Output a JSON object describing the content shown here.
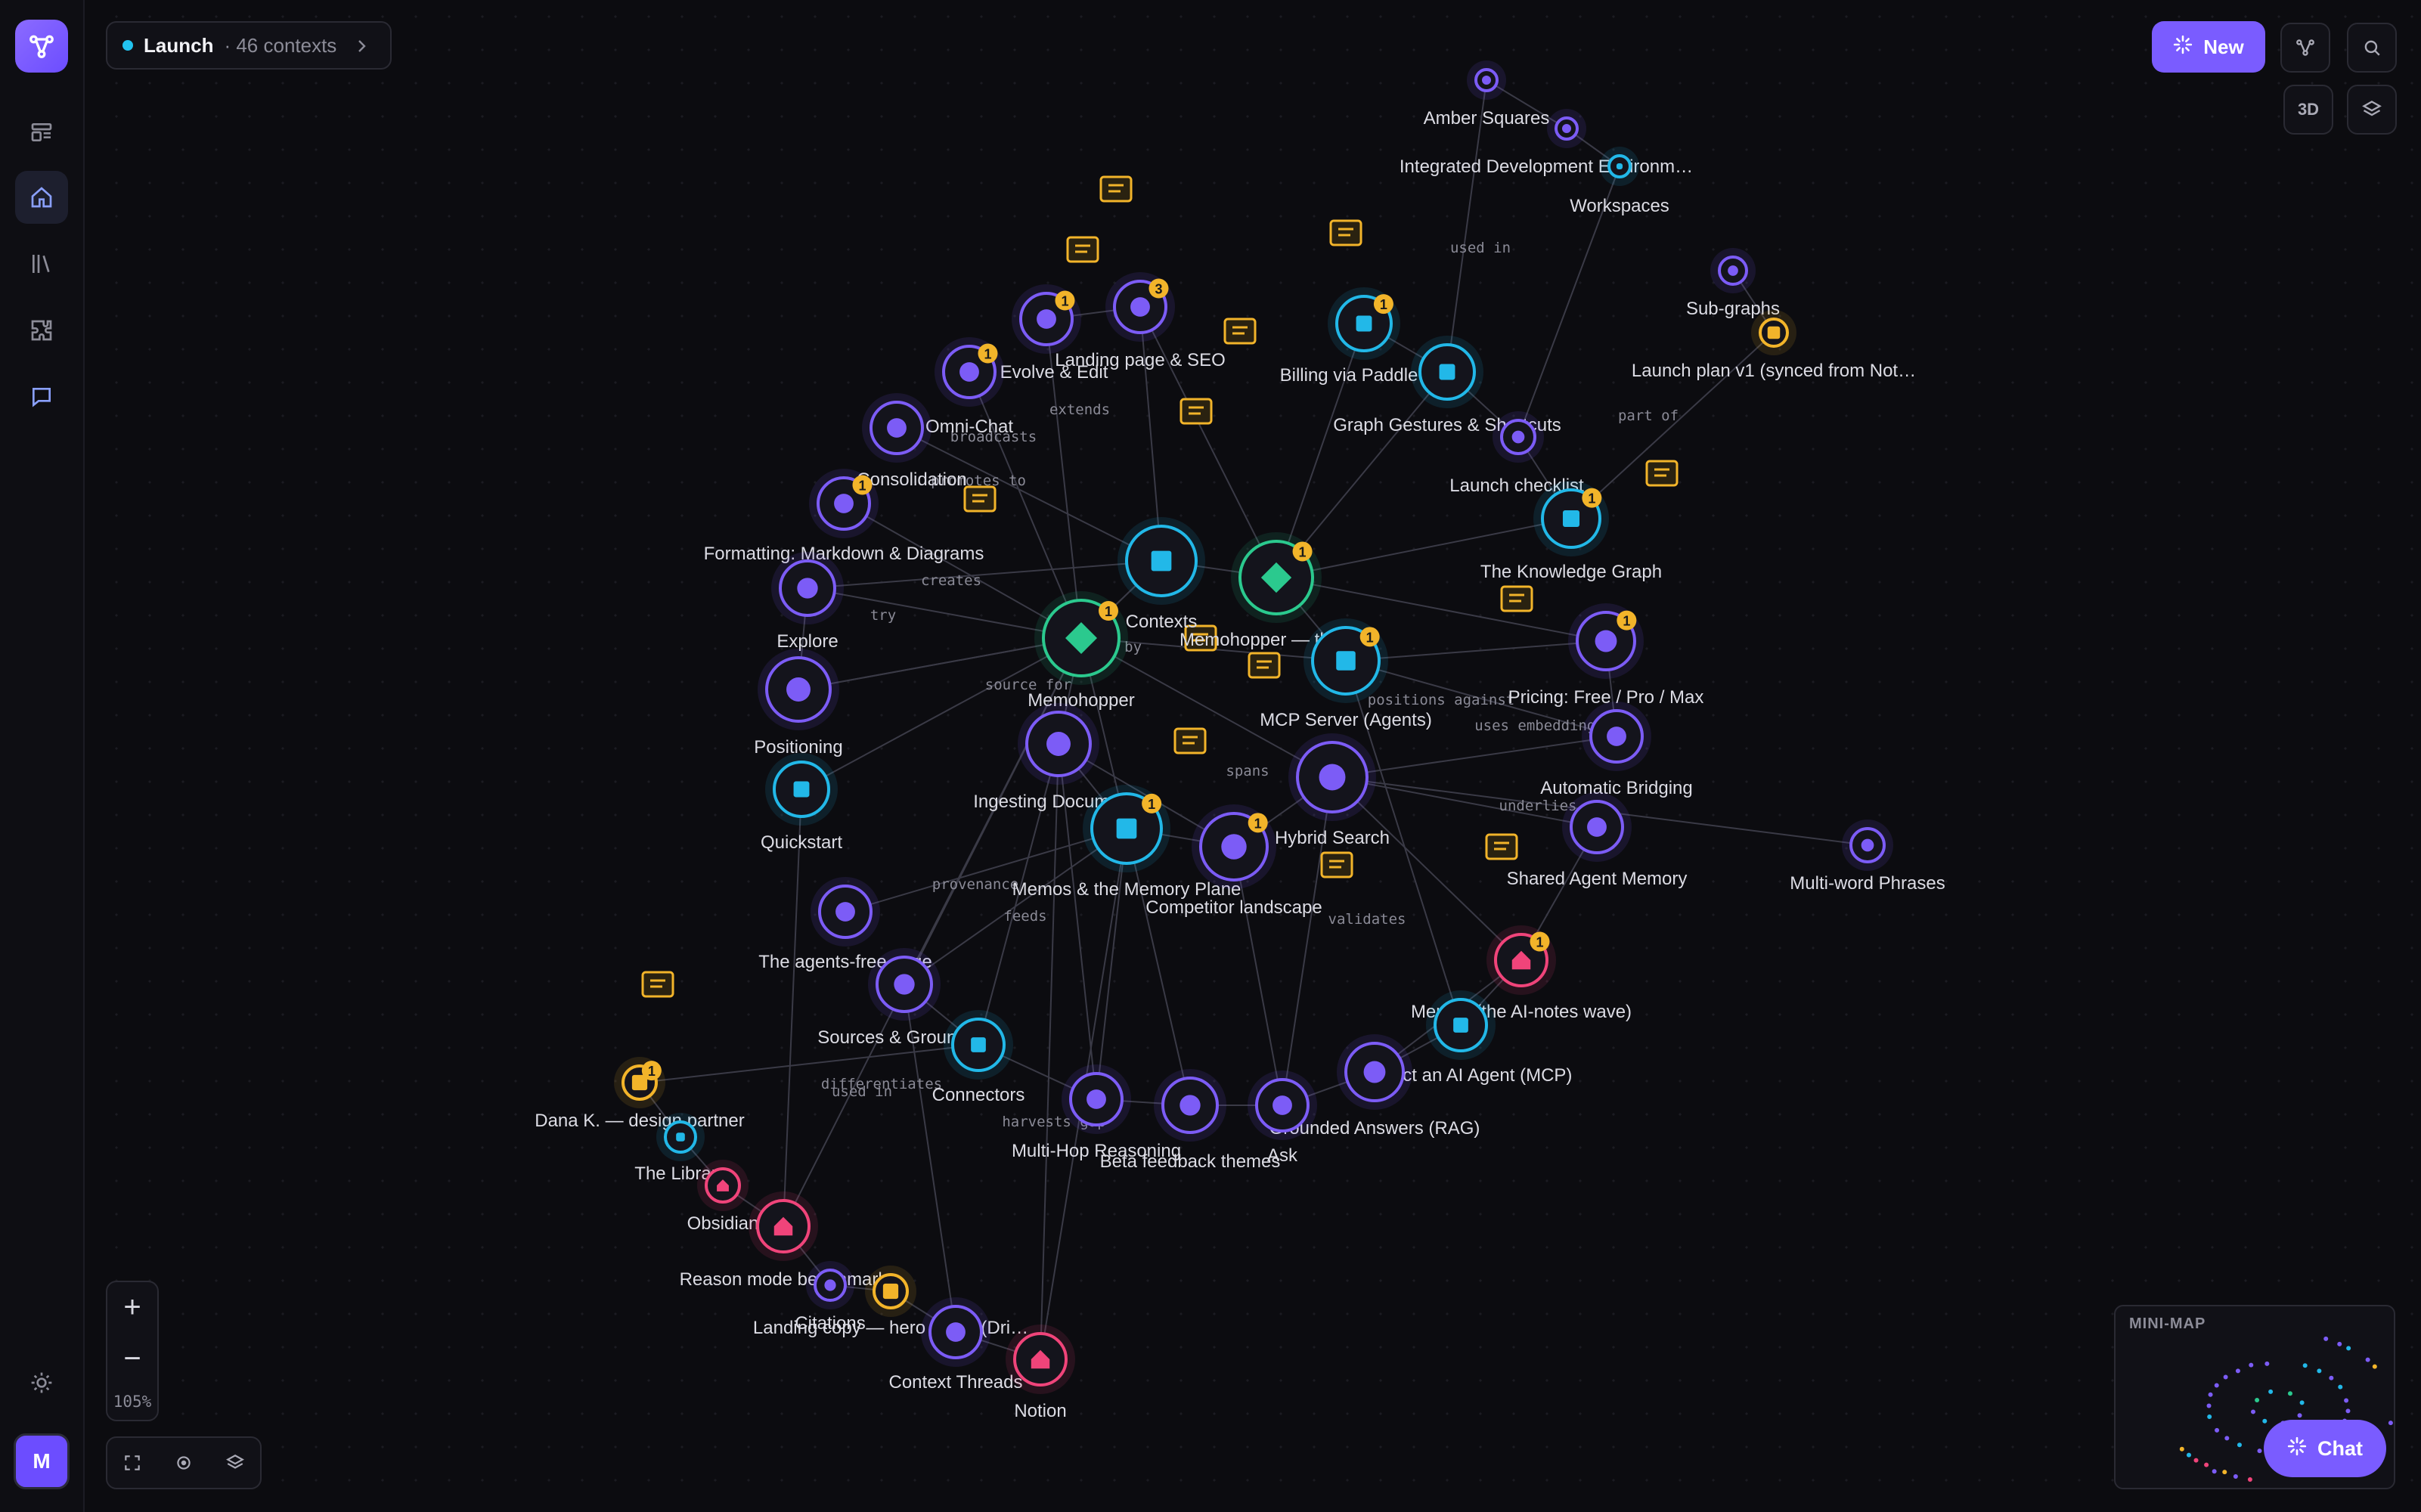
{
  "header": {
    "context_name": "Launch",
    "context_count": "· 46 contexts"
  },
  "toolbar": {
    "new_label": "New",
    "view_3d_label": "3D"
  },
  "rail": {
    "avatar_initial": "M",
    "items": [
      "layout-icon",
      "home-icon",
      "library-icon",
      "puzzle-icon",
      "chat-icon"
    ]
  },
  "zoom": {
    "level": "105%"
  },
  "minimap": {
    "label": "MINI-MAP"
  },
  "chat": {
    "label": "Chat"
  },
  "colors": {
    "accent": "#7a5cff",
    "memo": "#7c5cf6",
    "doc": "#22b8e8",
    "hub": "#2bc98e",
    "person": "#f0447a",
    "note": "#f2b42a",
    "edge": "#3a3a46"
  },
  "graph": {
    "nodes": [
      {
        "id": "amber",
        "label": "Amber Squares",
        "kind": "memo"
      },
      {
        "id": "ide",
        "label": "Integrated Development Environm…",
        "kind": "memo"
      },
      {
        "id": "workspaces",
        "label": "Workspaces",
        "kind": "doc"
      },
      {
        "id": "subgraphs",
        "label": "Sub-graphs",
        "kind": "memo"
      },
      {
        "id": "launchplan",
        "label": "Launch plan v1 (synced from Not…",
        "kind": "note"
      },
      {
        "id": "landing",
        "label": "Landing page & SEO",
        "kind": "memo",
        "badge": "3"
      },
      {
        "id": "evolve",
        "label": "Evolve & Edit",
        "kind": "memo",
        "badge": "1"
      },
      {
        "id": "omnichat",
        "label": "Omni-Chat",
        "kind": "memo",
        "badge": "1"
      },
      {
        "id": "consolidation",
        "label": "Consolidation",
        "kind": "memo"
      },
      {
        "id": "formatting",
        "label": "Formatting: Markdown & Diagrams",
        "kind": "memo",
        "badge": "1"
      },
      {
        "id": "billing",
        "label": "Billing via Paddle",
        "kind": "doc",
        "badge": "1"
      },
      {
        "id": "gestures",
        "label": "Graph Gestures & Shortcuts",
        "kind": "doc"
      },
      {
        "id": "checklist",
        "label": "Launch checklist",
        "kind": "memo"
      },
      {
        "id": "knowledge",
        "label": "The Knowledge Graph",
        "kind": "doc",
        "badge": "1"
      },
      {
        "id": "explore",
        "label": "Explore",
        "kind": "memo"
      },
      {
        "id": "contexts",
        "label": "Contexts",
        "kind": "doc"
      },
      {
        "id": "memohopperthe",
        "label": "Memohopper — the…",
        "kind": "hub",
        "badge": "1"
      },
      {
        "id": "memohopper",
        "label": "Memohopper",
        "kind": "hub",
        "badge": "1"
      },
      {
        "id": "mcpserver",
        "label": "MCP Server (Agents)",
        "kind": "doc",
        "badge": "1"
      },
      {
        "id": "pricing",
        "label": "Pricing: Free / Pro / Max",
        "kind": "memo",
        "badge": "1"
      },
      {
        "id": "positioning",
        "label": "Positioning",
        "kind": "memo"
      },
      {
        "id": "ingesting",
        "label": "Ingesting Documents",
        "kind": "memo"
      },
      {
        "id": "automatic",
        "label": "Automatic Bridging",
        "kind": "memo"
      },
      {
        "id": "quickstart",
        "label": "Quickstart",
        "kind": "doc"
      },
      {
        "id": "memos",
        "label": "Memos & the Memory Plane",
        "kind": "doc",
        "badge": "1"
      },
      {
        "id": "hybrid",
        "label": "Hybrid Search",
        "kind": "memo"
      },
      {
        "id": "competitor",
        "label": "Competitor landscape",
        "kind": "memo",
        "badge": "1"
      },
      {
        "id": "shared",
        "label": "Shared Agent Memory",
        "kind": "memo"
      },
      {
        "id": "multiword",
        "label": "Multi-word Phrases",
        "kind": "memo"
      },
      {
        "id": "agentsfree",
        "label": "The agents-free page",
        "kind": "memo"
      },
      {
        "id": "sources",
        "label": "Sources & Grounding",
        "kind": "memo"
      },
      {
        "id": "aiwave",
        "label": "Memos (the AI-notes wave)",
        "kind": "person",
        "badge": "1"
      },
      {
        "id": "connectors",
        "label": "Connectors",
        "kind": "doc"
      },
      {
        "id": "connectagent",
        "label": "Connect an AI Agent (MCP)",
        "kind": "doc"
      },
      {
        "id": "dana",
        "label": "Dana K. — design partner",
        "kind": "note",
        "badge": "1"
      },
      {
        "id": "library",
        "label": "The Library",
        "kind": "doc"
      },
      {
        "id": "grounded",
        "label": "Grounded Answers (RAG)",
        "kind": "memo"
      },
      {
        "id": "multihop",
        "label": "Multi-Hop Reasoning",
        "kind": "memo"
      },
      {
        "id": "beta",
        "label": "Beta feedback themes",
        "kind": "memo"
      },
      {
        "id": "ask",
        "label": "Ask",
        "kind": "memo"
      },
      {
        "id": "obsidian",
        "label": "Obsidian",
        "kind": "person"
      },
      {
        "id": "reasonmode",
        "label": "Reason mode benchmark",
        "kind": "person"
      },
      {
        "id": "citations",
        "label": "Citations",
        "kind": "memo"
      },
      {
        "id": "landingcopy",
        "label": "Landing copy — hero drafts (Dri…",
        "kind": "note"
      },
      {
        "id": "threads",
        "label": "Context Threads",
        "kind": "memo"
      },
      {
        "id": "notion",
        "label": "Notion",
        "kind": "person"
      }
    ],
    "edge_labels": [
      "used in",
      "part of",
      "extends",
      "broadcasts",
      "promotes to",
      "creates",
      "try",
      "source for",
      "used by",
      "positions against",
      "uses embeddings",
      "spans",
      "provenance",
      "feeds",
      "validates",
      "underlies",
      "differentiates",
      "harvests gap",
      "used in"
    ]
  }
}
